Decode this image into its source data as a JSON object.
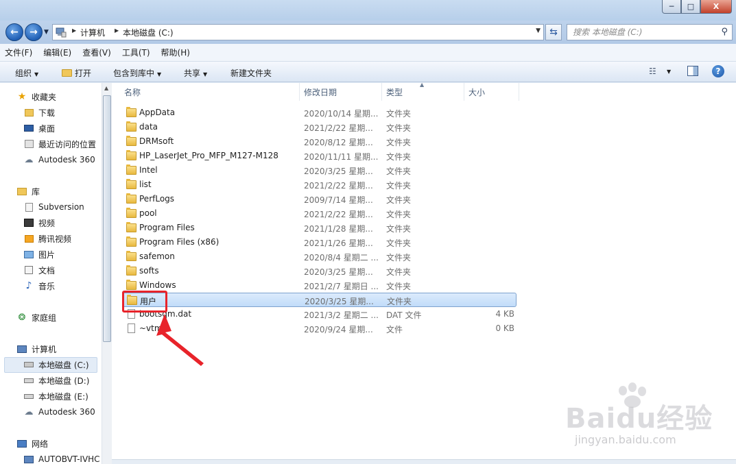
{
  "window": {
    "minimize": "─",
    "maximize": "□",
    "close": "X"
  },
  "address": {
    "crumbs": [
      "计算机",
      "本地磁盘 (C:)"
    ],
    "search_placeholder": "搜索 本地磁盘 (C:)"
  },
  "menu": [
    "文件(F)",
    "编辑(E)",
    "查看(V)",
    "工具(T)",
    "帮助(H)"
  ],
  "toolbar": {
    "organize": "组织",
    "open": "打开",
    "include_library": "包含到库中",
    "share": "共享",
    "new_folder": "新建文件夹"
  },
  "nav": {
    "favorites": "收藏夹",
    "fav_items": [
      "下载",
      "桌面",
      "最近访问的位置",
      "Autodesk 360"
    ],
    "libraries": "库",
    "lib_items": [
      "Subversion",
      "视频",
      "腾讯视频",
      "图片",
      "文档",
      "音乐"
    ],
    "homegroup": "家庭组",
    "computer": "计算机",
    "comp_items": [
      "本地磁盘 (C:)",
      "本地磁盘 (D:)",
      "本地磁盘 (E:)",
      "Autodesk 360"
    ],
    "network": "网络",
    "net_items": [
      "AUTOBVT-IVHC"
    ]
  },
  "columns": {
    "name": "名称",
    "date": "修改日期",
    "type": "类型",
    "size": "大小"
  },
  "files": [
    {
      "name": "AppData",
      "date": "2020/10/14 星期...",
      "type": "文件夹",
      "size": "",
      "kind": "folder"
    },
    {
      "name": "data",
      "date": "2021/2/22 星期...",
      "type": "文件夹",
      "size": "",
      "kind": "folder"
    },
    {
      "name": "DRMsoft",
      "date": "2020/8/12 星期...",
      "type": "文件夹",
      "size": "",
      "kind": "folder"
    },
    {
      "name": "HP_LaserJet_Pro_MFP_M127-M128",
      "date": "2020/11/11 星期...",
      "type": "文件夹",
      "size": "",
      "kind": "folder"
    },
    {
      "name": "Intel",
      "date": "2020/3/25 星期...",
      "type": "文件夹",
      "size": "",
      "kind": "folder"
    },
    {
      "name": "list",
      "date": "2021/2/22 星期...",
      "type": "文件夹",
      "size": "",
      "kind": "folder"
    },
    {
      "name": "PerfLogs",
      "date": "2009/7/14 星期...",
      "type": "文件夹",
      "size": "",
      "kind": "folder"
    },
    {
      "name": "pool",
      "date": "2021/2/22 星期...",
      "type": "文件夹",
      "size": "",
      "kind": "folder"
    },
    {
      "name": "Program Files",
      "date": "2021/1/28 星期...",
      "type": "文件夹",
      "size": "",
      "kind": "folder"
    },
    {
      "name": "Program Files (x86)",
      "date": "2021/1/26 星期...",
      "type": "文件夹",
      "size": "",
      "kind": "folder"
    },
    {
      "name": "safemon",
      "date": "2020/8/4 星期二 ...",
      "type": "文件夹",
      "size": "",
      "kind": "folder"
    },
    {
      "name": "softs",
      "date": "2020/3/25 星期...",
      "type": "文件夹",
      "size": "",
      "kind": "folder"
    },
    {
      "name": "Windows",
      "date": "2021/2/7 星期日 ...",
      "type": "文件夹",
      "size": "",
      "kind": "folder"
    },
    {
      "name": "用户",
      "date": "2020/3/25 星期...",
      "type": "文件夹",
      "size": "",
      "kind": "folder",
      "selected": true
    },
    {
      "name": "bootsqm.dat",
      "date": "2021/3/2 星期二 ...",
      "type": "DAT 文件",
      "size": "4 KB",
      "kind": "file"
    },
    {
      "name": "~vtmp",
      "date": "2020/9/24 星期...",
      "type": "文件",
      "size": "0 KB",
      "kind": "file"
    }
  ],
  "watermark": {
    "brand": "Baidu经验",
    "url": "jingyan.baidu.com"
  },
  "colors": {
    "selection": "#c1dcf9",
    "highlight": "#e8232a"
  }
}
